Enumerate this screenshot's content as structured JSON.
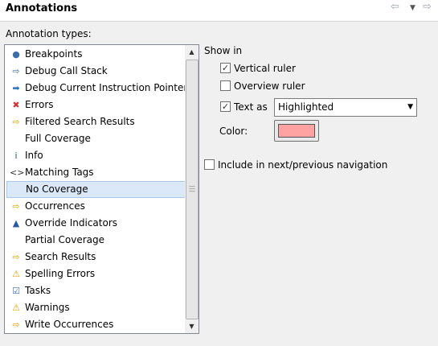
{
  "header": {
    "title": "Annotations",
    "back_icon": "arrow-left-icon",
    "menu_icon": "chevron-down-icon",
    "forward_icon": "arrow-right-icon"
  },
  "annotation_types": {
    "label": "Annotation types:",
    "items": [
      {
        "label": "Breakpoints",
        "icon": "breakpoint-icon",
        "glyph": "●",
        "color": "#3b6ea5"
      },
      {
        "label": "Debug Call Stack",
        "icon": "call-stack-arrow-icon",
        "glyph": "⇨",
        "color": "#3c6fb0"
      },
      {
        "label": "Debug Current Instruction Pointer",
        "icon": "instruction-pointer-icon",
        "glyph": "➡",
        "color": "#2f6fc0"
      },
      {
        "label": "Errors",
        "icon": "error-icon",
        "glyph": "✖",
        "color": "#d13438"
      },
      {
        "label": "Filtered Search Results",
        "icon": "search-result-arrow-icon",
        "glyph": "⇨",
        "color": "#e0a000"
      },
      {
        "label": "Full Coverage",
        "icon": "",
        "glyph": "",
        "color": "#000000"
      },
      {
        "label": "Info",
        "icon": "info-icon",
        "glyph": "i",
        "color": "#1f4e8c"
      },
      {
        "label": "Matching Tags",
        "icon": "tag-brackets-icon",
        "glyph": "<>",
        "color": "#333333"
      },
      {
        "label": "No Coverage",
        "icon": "",
        "glyph": "",
        "color": "#000000",
        "selected": true
      },
      {
        "label": "Occurrences",
        "icon": "occurrence-arrow-icon",
        "glyph": "⇨",
        "color": "#e0a000"
      },
      {
        "label": "Override Indicators",
        "icon": "override-triangle-icon",
        "glyph": "▲",
        "color": "#2a5aa0"
      },
      {
        "label": "Partial Coverage",
        "icon": "",
        "glyph": "",
        "color": "#000000"
      },
      {
        "label": "Search Results",
        "icon": "search-result-arrow-icon",
        "glyph": "⇨",
        "color": "#e0a000"
      },
      {
        "label": "Spelling Errors",
        "icon": "warning-icon",
        "glyph": "⚠",
        "color": "#e0a000"
      },
      {
        "label": "Tasks",
        "icon": "task-checklist-icon",
        "glyph": "☑",
        "color": "#3c6fb0"
      },
      {
        "label": "Warnings",
        "icon": "warning-icon",
        "glyph": "⚠",
        "color": "#e0a000"
      },
      {
        "label": "Write Occurrences",
        "icon": "occurrence-arrow-icon",
        "glyph": "⇨",
        "color": "#e0a000"
      }
    ]
  },
  "show_in": {
    "label": "Show in",
    "vertical_ruler": {
      "label": "Vertical ruler",
      "checked": true
    },
    "overview_ruler": {
      "label": "Overview ruler",
      "checked": false
    },
    "text_as": {
      "label": "Text as",
      "checked": true,
      "selected": "Highlighted"
    },
    "color": {
      "label": "Color:",
      "value": "#ffa2a2"
    }
  },
  "include_navigation": {
    "label": "Include in next/previous navigation",
    "checked": false
  }
}
